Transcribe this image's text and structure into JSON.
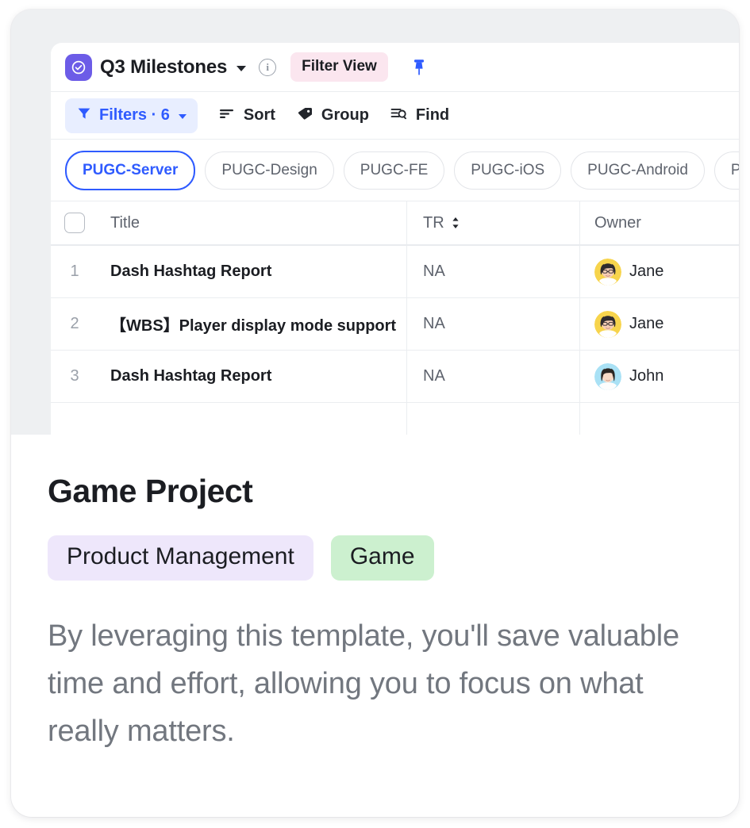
{
  "window": {
    "background_color": "#eef0f2",
    "card_background": "#ffffff"
  },
  "app": {
    "logo_icon": "check-circle-icon",
    "logo_color": "#6c5ce7",
    "view_title": "Q3 Milestones",
    "title_caret_icon": "chevron-down-icon",
    "info_icon": "info-icon",
    "info_glyph": "i",
    "badge": {
      "label": "Filter View",
      "background": "#fbe6ef",
      "text_color": "#1b1d22"
    },
    "pin_icon": "pin-icon",
    "pin_color": "#2f5bff"
  },
  "toolbar": {
    "filters": {
      "icon": "funnel-icon",
      "label": "Filters · 6",
      "caret_icon": "chevron-down-icon",
      "background": "#e8eeff",
      "color": "#2f5bff"
    },
    "items": [
      {
        "label": "Sort",
        "icon": "sort-lines-icon"
      },
      {
        "label": "Group",
        "icon": "tag-icon"
      },
      {
        "label": "Find",
        "icon": "find-lines-search-icon"
      }
    ]
  },
  "tabs": {
    "active_color": "#2f5bff",
    "items": [
      {
        "label": "PUGC-Server",
        "active": true
      },
      {
        "label": "PUGC-Design",
        "active": false
      },
      {
        "label": "PUGC-FE",
        "active": false
      },
      {
        "label": "PUGC-iOS",
        "active": false
      },
      {
        "label": "PUGC-Android",
        "active": false
      },
      {
        "label": "PUG",
        "active": false
      }
    ]
  },
  "table": {
    "header": {
      "checkbox_icon": "checkbox-unchecked-icon",
      "title": "Title",
      "tr": "TR",
      "tr_sort_icon": "sort-arrows-icon",
      "owner": "Owner"
    },
    "rows": [
      {
        "num": "1",
        "title": "Dash Hashtag Report",
        "tr": "NA",
        "owner": "Jane",
        "avatar_bg": "#f7d44c",
        "avatar_icon": "avatar-jane"
      },
      {
        "num": "2",
        "title": "【WBS】Player display mode support",
        "tr": "NA",
        "owner": "Jane",
        "avatar_bg": "#f7d44c",
        "avatar_icon": "avatar-jane"
      },
      {
        "num": "3",
        "title": "Dash Hashtag Report",
        "tr": "NA",
        "owner": "John",
        "avatar_bg": "#a9e1f5",
        "avatar_icon": "avatar-john"
      }
    ]
  },
  "detail": {
    "project_title": "Game Project",
    "tags": [
      {
        "label": "Product Management",
        "background": "#eee7fb"
      },
      {
        "label": "Game",
        "background": "#ccf0cf"
      }
    ],
    "description": "By leveraging this template, you'll save valuable time and effort, allowing you to focus on what really matters."
  }
}
